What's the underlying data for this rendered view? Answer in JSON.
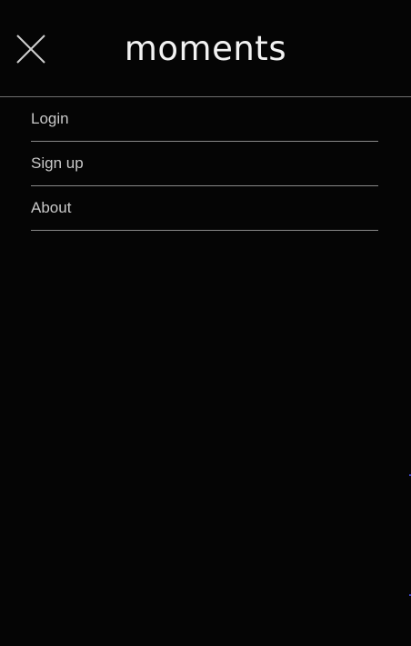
{
  "header": {
    "brand": "moments",
    "close_icon": "close-icon"
  },
  "menu": {
    "items": [
      {
        "label": "Login"
      },
      {
        "label": "Sign up"
      },
      {
        "label": "About"
      }
    ]
  },
  "colors": {
    "background": "#050505",
    "text": "#d8d8d8",
    "divider": "#8a8a8a"
  }
}
